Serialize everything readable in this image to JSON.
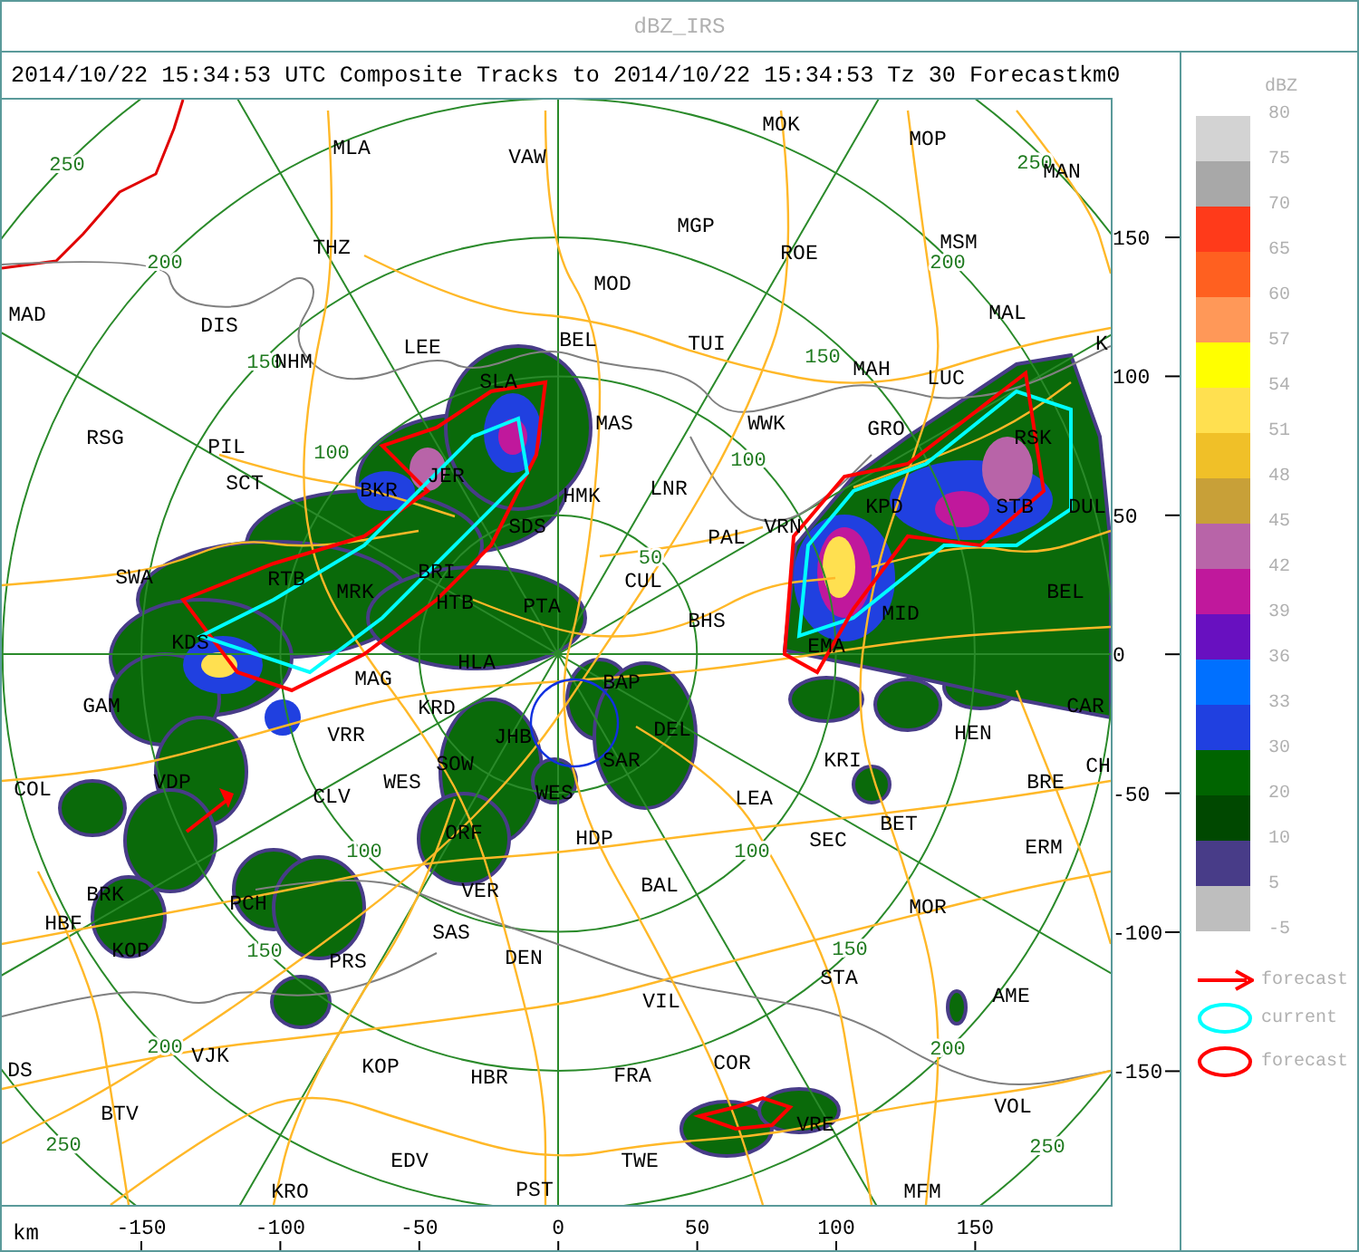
{
  "window": {
    "title": "dBZ_IRS"
  },
  "header": {
    "title": "2014/10/22 15:34:53 UTC Composite Tracks to 2014/10/22 15:34:53 Tz 30 Forecast",
    "unit": "km",
    "value": "0"
  },
  "map": {
    "cities": [
      "MOK",
      "MOP",
      "MLA",
      "VAW",
      "MAN",
      "MGP",
      "THZ",
      "ROE",
      "MSM",
      "MOD",
      "MAD",
      "DIS",
      "MAL",
      "LEE",
      "BEL",
      "TUI",
      "K",
      "NHM",
      "SLA",
      "MAH",
      "LUC",
      "RSG",
      "PIL",
      "MAS",
      "WWK",
      "GRO",
      "RSK",
      "SCT",
      "BKR",
      "JER",
      "HMK",
      "LNR",
      "KPD",
      "STB",
      "DUL",
      "SDS",
      "PAL",
      "VRN",
      "SWA",
      "RTB",
      "BRI",
      "CUL",
      "MRK",
      "BEL",
      "HTB",
      "PTA",
      "BHS",
      "MID",
      "KDS",
      "EMA",
      "HLA",
      "MAG",
      "BAP",
      "GAM",
      "KRD",
      "CAR",
      "VRR",
      "JHB",
      "DEL",
      "HEN",
      "SOW",
      "SAR",
      "KRI",
      "CH",
      "COL",
      "VDP",
      "CLV",
      "WES",
      "WES",
      "LEA",
      "BRE",
      "ORF",
      "HDP",
      "SEC",
      "BET",
      "ERM",
      "BRK",
      "PCH",
      "VER",
      "BAL",
      "MOR",
      "HBF",
      "SAS",
      "KOP",
      "PRS",
      "DEN",
      "STA",
      "VIL",
      "AME",
      "DS",
      "VJK",
      "KOP",
      "HBR",
      "FRA",
      "COR",
      "BTV",
      "VRE",
      "VOL",
      "EDV",
      "TWE",
      "KRO",
      "PST",
      "MFM"
    ],
    "range_ring_labels": [
      "250",
      "250",
      "200",
      "200",
      "150",
      "150",
      "100",
      "100",
      "50",
      "100",
      "100",
      "150",
      "150",
      "200",
      "200",
      "250",
      "250"
    ]
  },
  "y_axis": {
    "ticks": [
      "150",
      "100",
      "50",
      "0",
      "-50",
      "-100",
      "-150"
    ]
  },
  "x_axis": {
    "unit": "km",
    "ticks": [
      "-150",
      "-100",
      "-50",
      "0",
      "50",
      "100",
      "150"
    ]
  },
  "legend": {
    "title": "dBZ",
    "ticks": [
      "80",
      "75",
      "70",
      "65",
      "60",
      "57",
      "54",
      "51",
      "48",
      "45",
      "42",
      "39",
      "36",
      "33",
      "30",
      "20",
      "10",
      "5",
      "-5"
    ],
    "bins": [
      {
        "color": "#d3d3d3"
      },
      {
        "color": "#a8a8a8"
      },
      {
        "color": "#ff3a1a"
      },
      {
        "color": "#ff6020"
      },
      {
        "color": "#ff9858"
      },
      {
        "color": "#ffff00"
      },
      {
        "color": "#ffe050"
      },
      {
        "color": "#f0c028"
      },
      {
        "color": "#c8a038"
      },
      {
        "color": "#b864a8"
      },
      {
        "color": "#c0189c"
      },
      {
        "color": "#6810c0"
      },
      {
        "color": "#0070ff"
      },
      {
        "color": "#2040e0"
      },
      {
        "color": "#006400"
      },
      {
        "color": "#004800"
      },
      {
        "color": "#483c88"
      },
      {
        "color": "#bebebe"
      }
    ],
    "symbols": [
      {
        "kind": "arrow",
        "color": "#ff0000",
        "label": "forecast"
      },
      {
        "kind": "ellipse",
        "color": "#00ffff",
        "label": "current"
      },
      {
        "kind": "ellipse",
        "color": "#ff0000",
        "label": "forecast"
      }
    ]
  }
}
